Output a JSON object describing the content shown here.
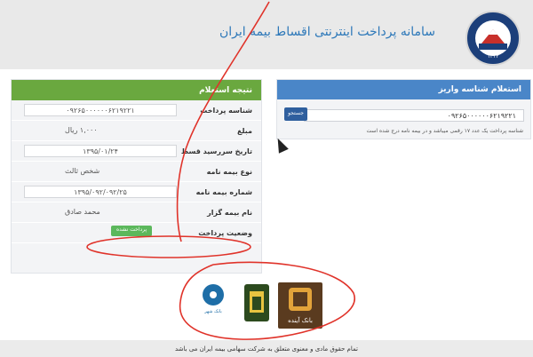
{
  "header": {
    "title": "سامانه پرداخت اینترنتی اقساط بیمه ایران",
    "logo_year": "۱۳۱۴"
  },
  "inquiry_panel": {
    "title": "استعلام شناسه واریز",
    "input_value": "۰۹۲۶۵۰۰۰۰۰۰۶۲۱۹۲۲۱",
    "button_label": "جستجو",
    "hint": "شناسه پرداخت یک عدد ۱۷ رقمی میباشد و در بیمه نامه درج شده است"
  },
  "result_panel": {
    "title": "نتیجه استعلام",
    "rows": [
      {
        "label": "شناسه پرداخت",
        "value": "۰۹۲۶۵۰۰۰۰۰۰۶۲۱۹۲۲۱"
      },
      {
        "label": "مبلغ",
        "value": "۱,۰۰۰ ریال"
      },
      {
        "label": "تاریخ سررسید قسط",
        "value": "۱۳۹۵/۰۱/۲۴"
      },
      {
        "label": "نوع بیمه نامه",
        "value": "شخص ثالث"
      },
      {
        "label": "شماره بیمه نامه",
        "value": "۱۳۹۵/۰۹۲/۰۹۲/۲۵"
      },
      {
        "label": "نام بیمه گزار",
        "value": "محمد صادق"
      },
      {
        "label": "وضعیت پرداخت",
        "value": "پرداخت نشده"
      }
    ]
  },
  "banks": {
    "ayandeh": "بانک آینده",
    "shahr": "بانک شهر"
  },
  "footer": {
    "text": "تمام حقوق مادی و معنوی متعلق به شرکت سهامی بیمه ایران می باشد"
  },
  "colors": {
    "result_head": "#6aa83f",
    "inquiry_head": "#4a86c8",
    "annotation_red": "#e0332a"
  }
}
